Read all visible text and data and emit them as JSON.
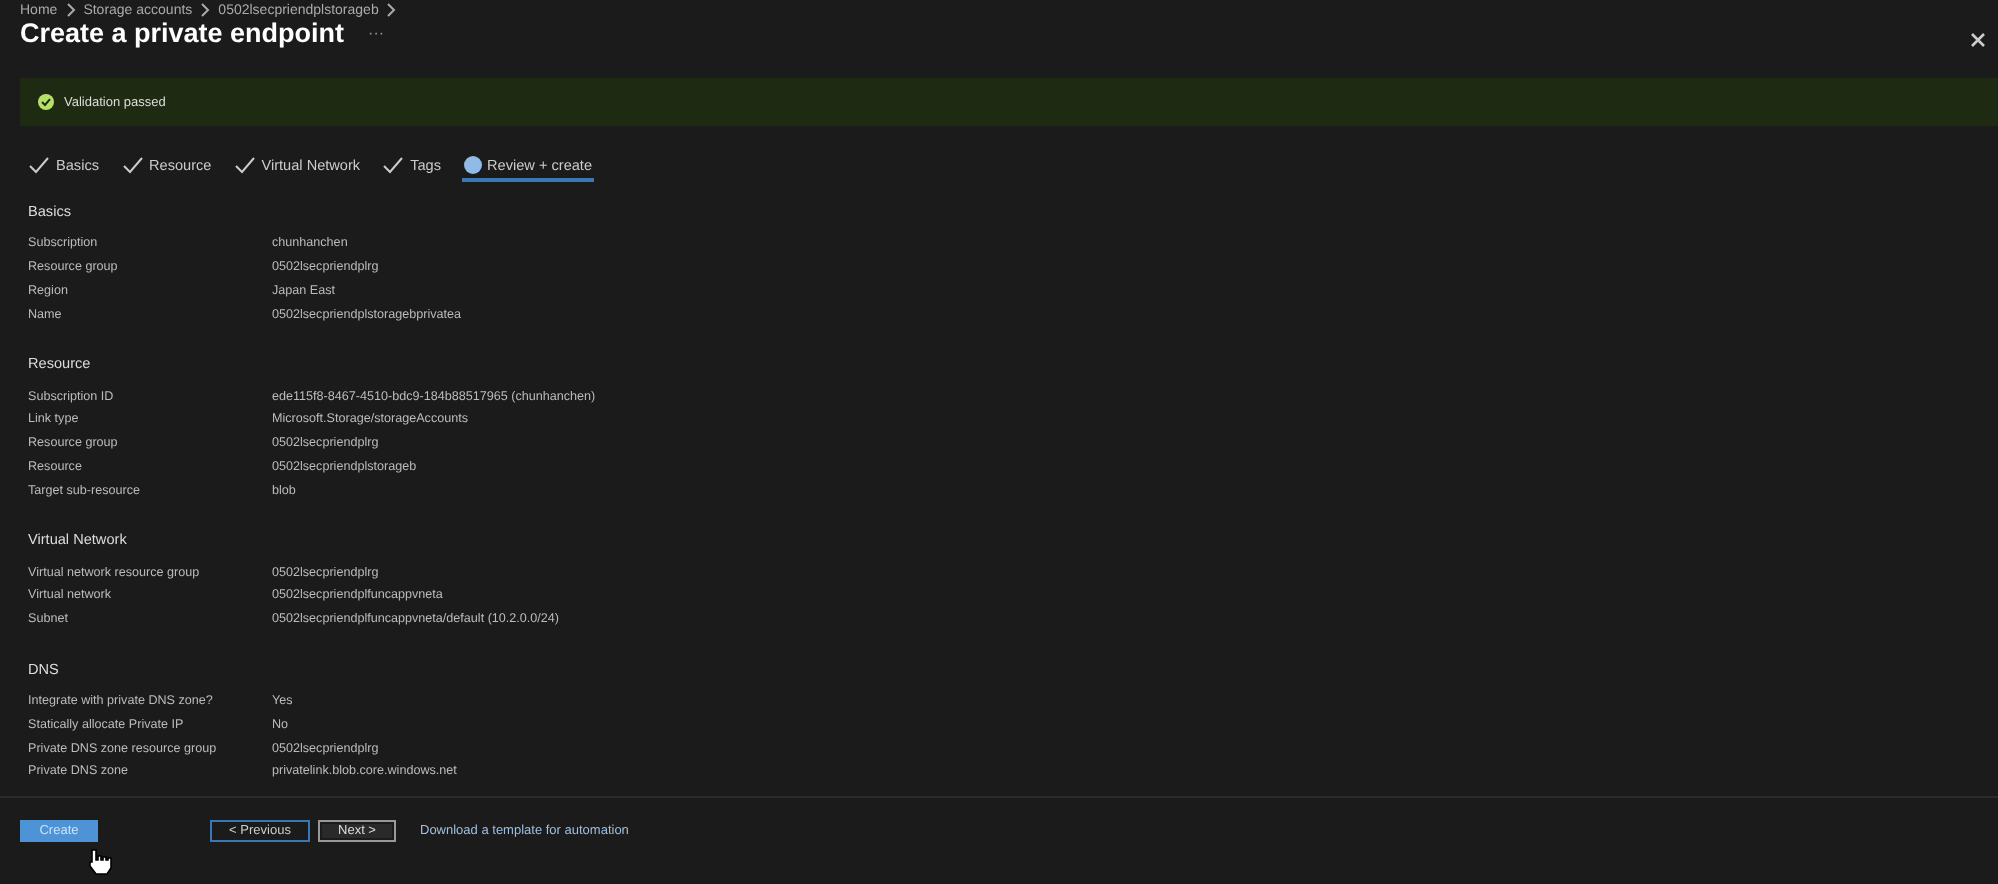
{
  "breadcrumb": [
    "Home",
    "Storage accounts",
    "0502lsecpriendplstorageb"
  ],
  "title": "Create a private endpoint",
  "more": "···",
  "banner": {
    "passed": true,
    "text": "Validation passed"
  },
  "tabs": [
    {
      "label": "Basics",
      "completed": true,
      "selected": false
    },
    {
      "label": "Resource",
      "completed": true,
      "selected": false
    },
    {
      "label": "Virtual Network",
      "completed": true,
      "selected": false
    },
    {
      "label": "Tags",
      "completed": true,
      "selected": false
    },
    {
      "label": "Review + create",
      "completed": false,
      "selected": true
    }
  ],
  "sections": [
    {
      "heading": "Basics",
      "rows": [
        [
          "Subscription",
          "chunhanchen"
        ],
        [
          "Resource group",
          "0502lsecpriendplrg"
        ],
        [
          "Region",
          "Japan East"
        ],
        [
          "Name",
          "0502lsecpriendplstoragebprivatea"
        ]
      ]
    },
    {
      "heading": "Resource",
      "rows": [
        [
          "Subscription ID",
          "ede115f8-8467-4510-bdc9-184b88517965 (chunhanchen)"
        ],
        [
          "Link type",
          "Microsoft.Storage/storageAccounts"
        ],
        [
          "Resource group",
          "0502lsecpriendplrg"
        ],
        [
          "Resource",
          "0502lsecpriendplstorageb"
        ],
        [
          "Target sub-resource",
          "blob"
        ]
      ]
    },
    {
      "heading": "Virtual Network",
      "rows": [
        [
          "Virtual network resource group",
          "0502lsecpriendplrg"
        ],
        [
          "Virtual network",
          "0502lsecpriendplfuncappvneta"
        ],
        [
          "Subnet",
          "0502lsecpriendplfuncappvneta/default (10.2.0.0/24)"
        ]
      ]
    },
    {
      "heading": "DNS",
      "rows": [
        [
          "Integrate with private DNS zone?",
          "Yes"
        ],
        [
          "Statically allocate Private IP",
          "No"
        ],
        [
          "Private DNS zone resource group",
          "0502lsecpriendplrg"
        ],
        [
          "Private DNS zone",
          "privatelink.blob.core.windows.net"
        ]
      ]
    }
  ],
  "footer": {
    "create": "Create",
    "previous": "< Previous",
    "next": "Next >",
    "link": "Download a template for automation"
  }
}
